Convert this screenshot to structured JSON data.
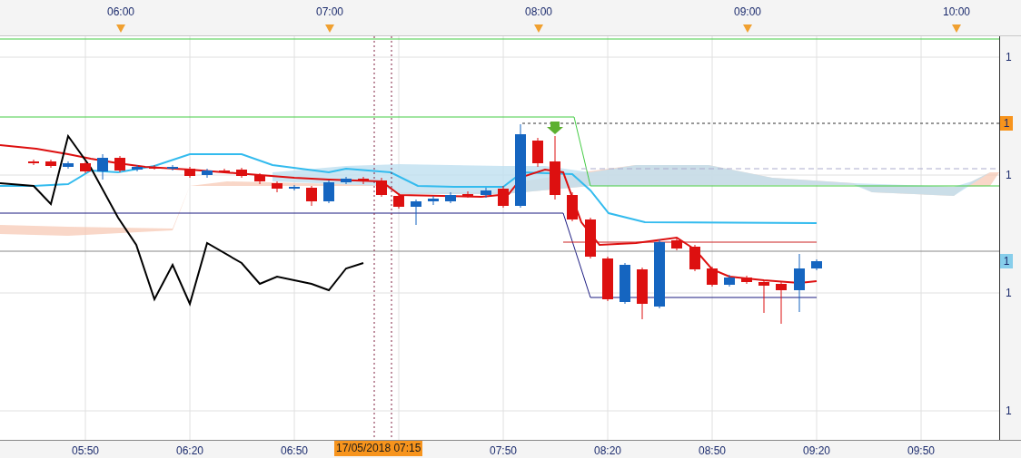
{
  "top_axis": {
    "labels": [
      "06:00",
      "07:00",
      "08:00",
      "09:00",
      "10:00"
    ]
  },
  "bottom_axis": {
    "labels": [
      "05:50",
      "06:20",
      "06:50",
      "07:50",
      "08:20",
      "08:50",
      "09:20",
      "09:50"
    ],
    "cursor_label": "17/05/2018 07:15"
  },
  "price_axis": {
    "labels": [
      "1",
      "1",
      "1",
      "1"
    ],
    "markers": [
      {
        "text": "1",
        "color": "#f7941d"
      },
      {
        "text": "1",
        "color": "#87ceeb"
      }
    ]
  }
}
